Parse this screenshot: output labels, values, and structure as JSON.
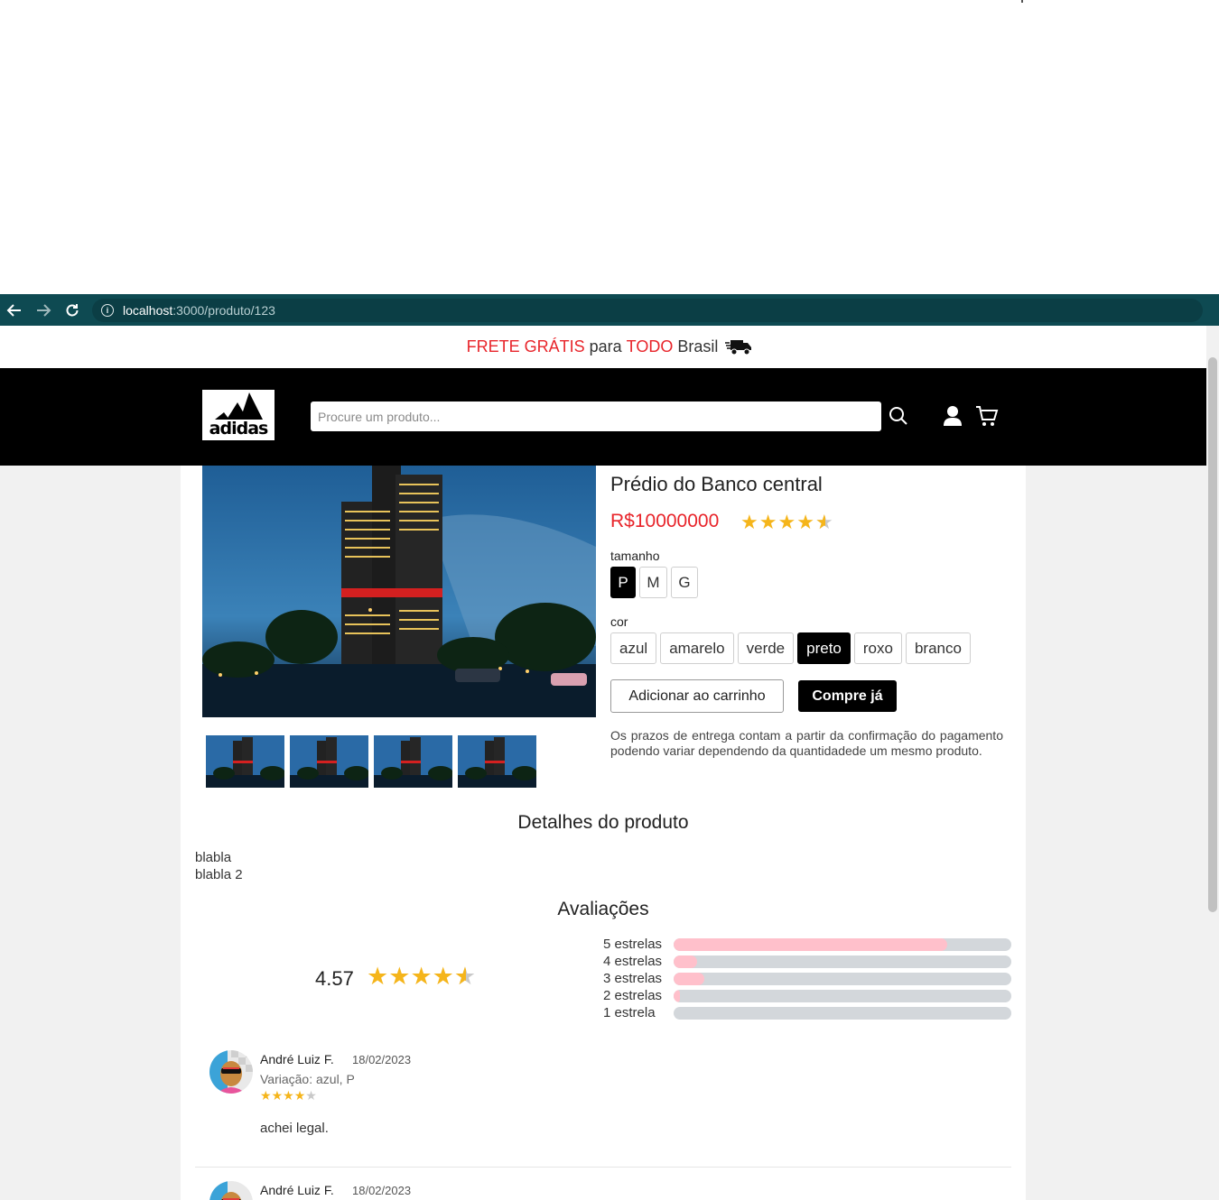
{
  "browser": {
    "url_host": "localhost",
    "url_path": ":3000/produto/123"
  },
  "announcement": {
    "part1": "FRETE GRÁTIS",
    "part2": " para ",
    "part3": "TODO",
    "part4": " Brasil"
  },
  "header": {
    "logo_text": "adidas",
    "search_placeholder": "Procure um produto..."
  },
  "product": {
    "title": "Prédio do Banco central",
    "price": "R$10000000",
    "size_label": "tamanho",
    "sizes": [
      "P",
      "M",
      "G"
    ],
    "selected_size": "P",
    "color_label": "cor",
    "colors": [
      "azul",
      "amarelo",
      "verde",
      "preto",
      "roxo",
      "branco"
    ],
    "selected_color": "preto",
    "add_to_cart": "Adicionar ao carrinho",
    "buy_now": "Compre já",
    "delivery_note": "Os prazos de entrega contam a partir da confirmação do pagamento podendo variar dependendo da quantidadede um mesmo produto."
  },
  "details": {
    "title": "Detalhes do produto",
    "lines": [
      "blabla",
      "blabla 2"
    ]
  },
  "ratings": {
    "title": "Avaliações",
    "average": "4.57",
    "average_value": 4.57,
    "distribution": [
      {
        "label": "5 estrelas",
        "fraction": 0.81
      },
      {
        "label": "4 estrelas",
        "fraction": 0.07
      },
      {
        "label": "3 estrelas",
        "fraction": 0.09
      },
      {
        "label": "2 estrelas",
        "fraction": 0.02
      },
      {
        "label": "1 estrela",
        "fraction": 0.0
      }
    ]
  },
  "reviews": [
    {
      "name": "André Luiz F.",
      "date": "18/02/2023",
      "variation": "Variação: azul, P",
      "stars": 4,
      "text": "achei legal."
    },
    {
      "name": "André Luiz F.",
      "date": "18/02/2023"
    }
  ],
  "colors": {
    "browser_bar": "#0e4a52",
    "accent_red": "#e8242a",
    "star": "#f5b51b",
    "bar_fill": "#ffc0cb"
  }
}
